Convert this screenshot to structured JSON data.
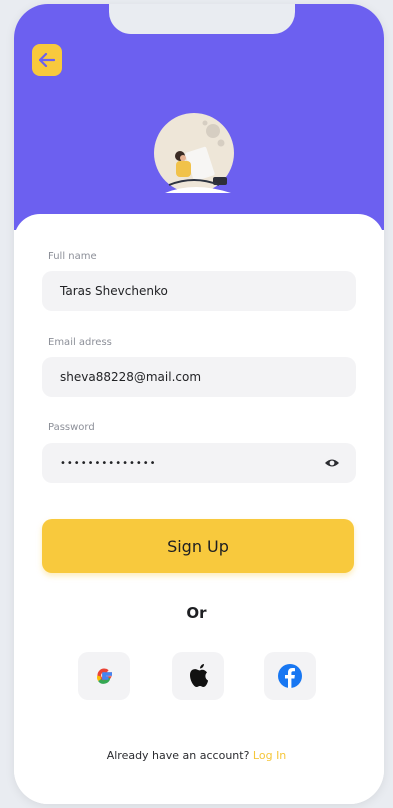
{
  "form": {
    "full_name_label": "Full name",
    "full_name_value": "Taras Shevchenko",
    "email_label": "Email adress",
    "email_value": "sheva88228@mail.com",
    "password_label": "Password",
    "password_mask": "••••••••••••••"
  },
  "actions": {
    "signup_label": "Sign Up",
    "or_label": "Or"
  },
  "footer": {
    "prompt": "Already have an account?",
    "login_label": "Log In"
  },
  "colors": {
    "header": "#6c60f0",
    "accent": "#f8c93d",
    "field_bg": "#f3f3f5"
  },
  "icons": {
    "back": "arrow-left-icon",
    "eye": "eye-icon",
    "google": "google-icon",
    "apple": "apple-icon",
    "facebook": "facebook-icon"
  }
}
